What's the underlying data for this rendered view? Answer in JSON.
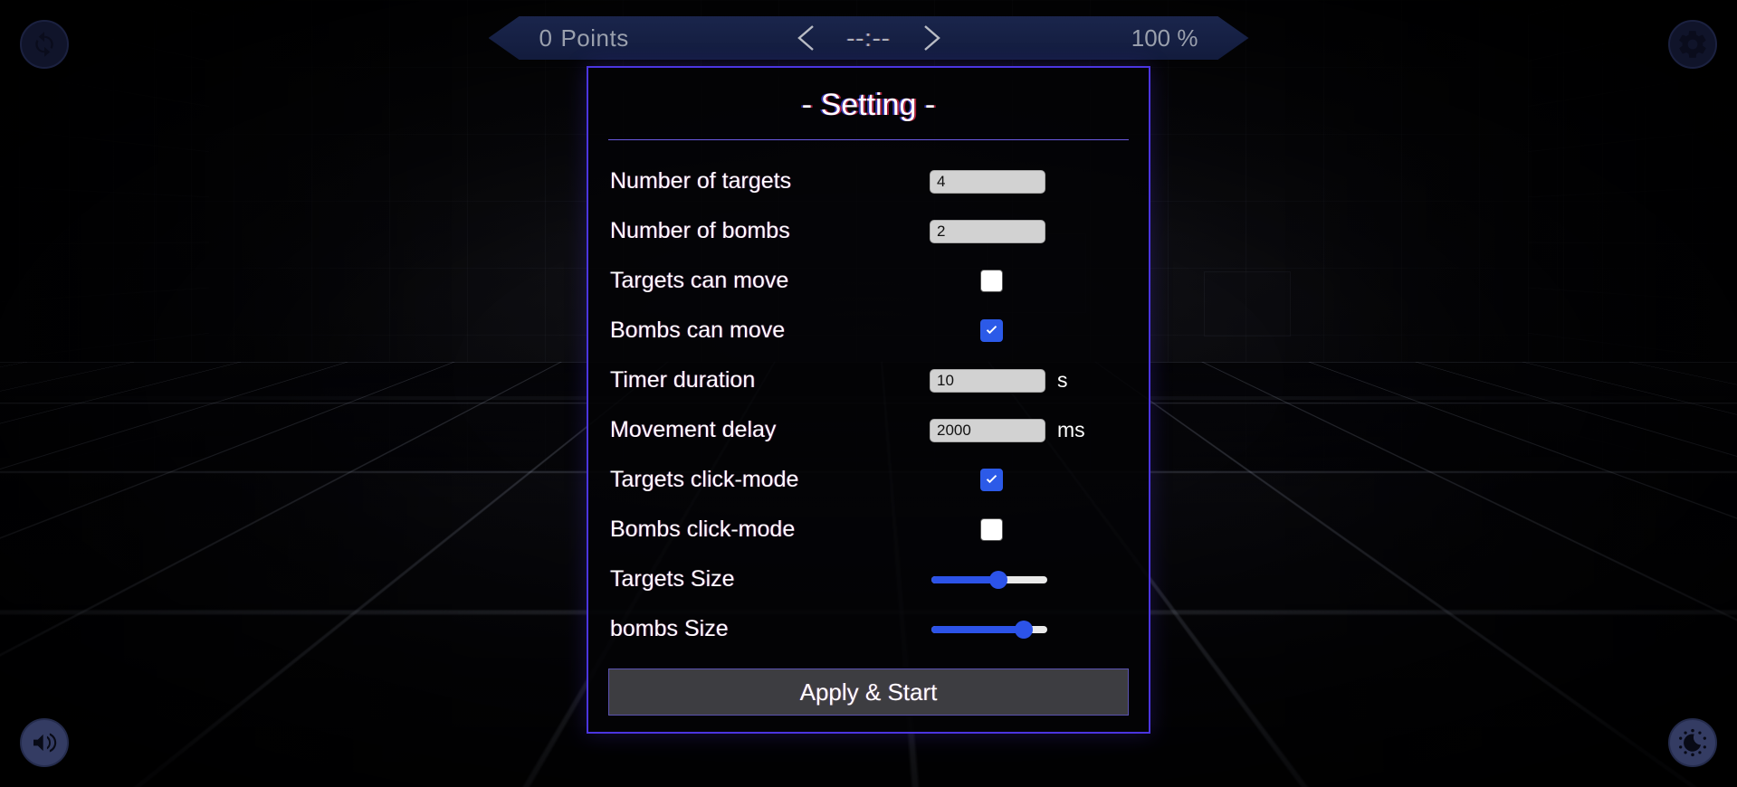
{
  "hud": {
    "points_value": "0",
    "points_label": "Points",
    "timer": "--:--",
    "percent": "100 %",
    "prev_icon": "chevron-left-icon",
    "next_icon": "chevron-right-icon"
  },
  "corner_buttons": [
    {
      "name": "reset-button",
      "icon": "refresh-icon"
    },
    {
      "name": "settings-button",
      "icon": "gear-icon"
    },
    {
      "name": "sound-button",
      "icon": "speaker-icon"
    },
    {
      "name": "theme-button",
      "icon": "moon-icon"
    }
  ],
  "panel": {
    "title": "- Setting -",
    "apply_label": "Apply & Start",
    "rows": [
      {
        "label": "Number of targets",
        "type": "number",
        "value": "4"
      },
      {
        "label": "Number of bombs",
        "type": "number",
        "value": "2"
      },
      {
        "label": "Targets can move",
        "type": "checkbox",
        "checked": false
      },
      {
        "label": "Bombs can move",
        "type": "checkbox",
        "checked": true
      },
      {
        "label": "Timer duration",
        "type": "number",
        "value": "10",
        "unit": "s"
      },
      {
        "label": "Movement delay",
        "type": "number",
        "value": "2000",
        "unit": "ms"
      },
      {
        "label": "Targets click-mode",
        "type": "checkbox",
        "checked": true
      },
      {
        "label": "Bombs click-mode",
        "type": "checkbox",
        "checked": false
      },
      {
        "label": "Targets Size",
        "type": "slider",
        "percent": 58
      },
      {
        "label": "bombs Size",
        "type": "slider",
        "percent": 80
      }
    ]
  },
  "colors": {
    "accent_blue": "#2c53e8",
    "panel_border": "#4b35e0",
    "hud_bg": "#1c2852",
    "checkbox_on": "#2c5ae8"
  }
}
